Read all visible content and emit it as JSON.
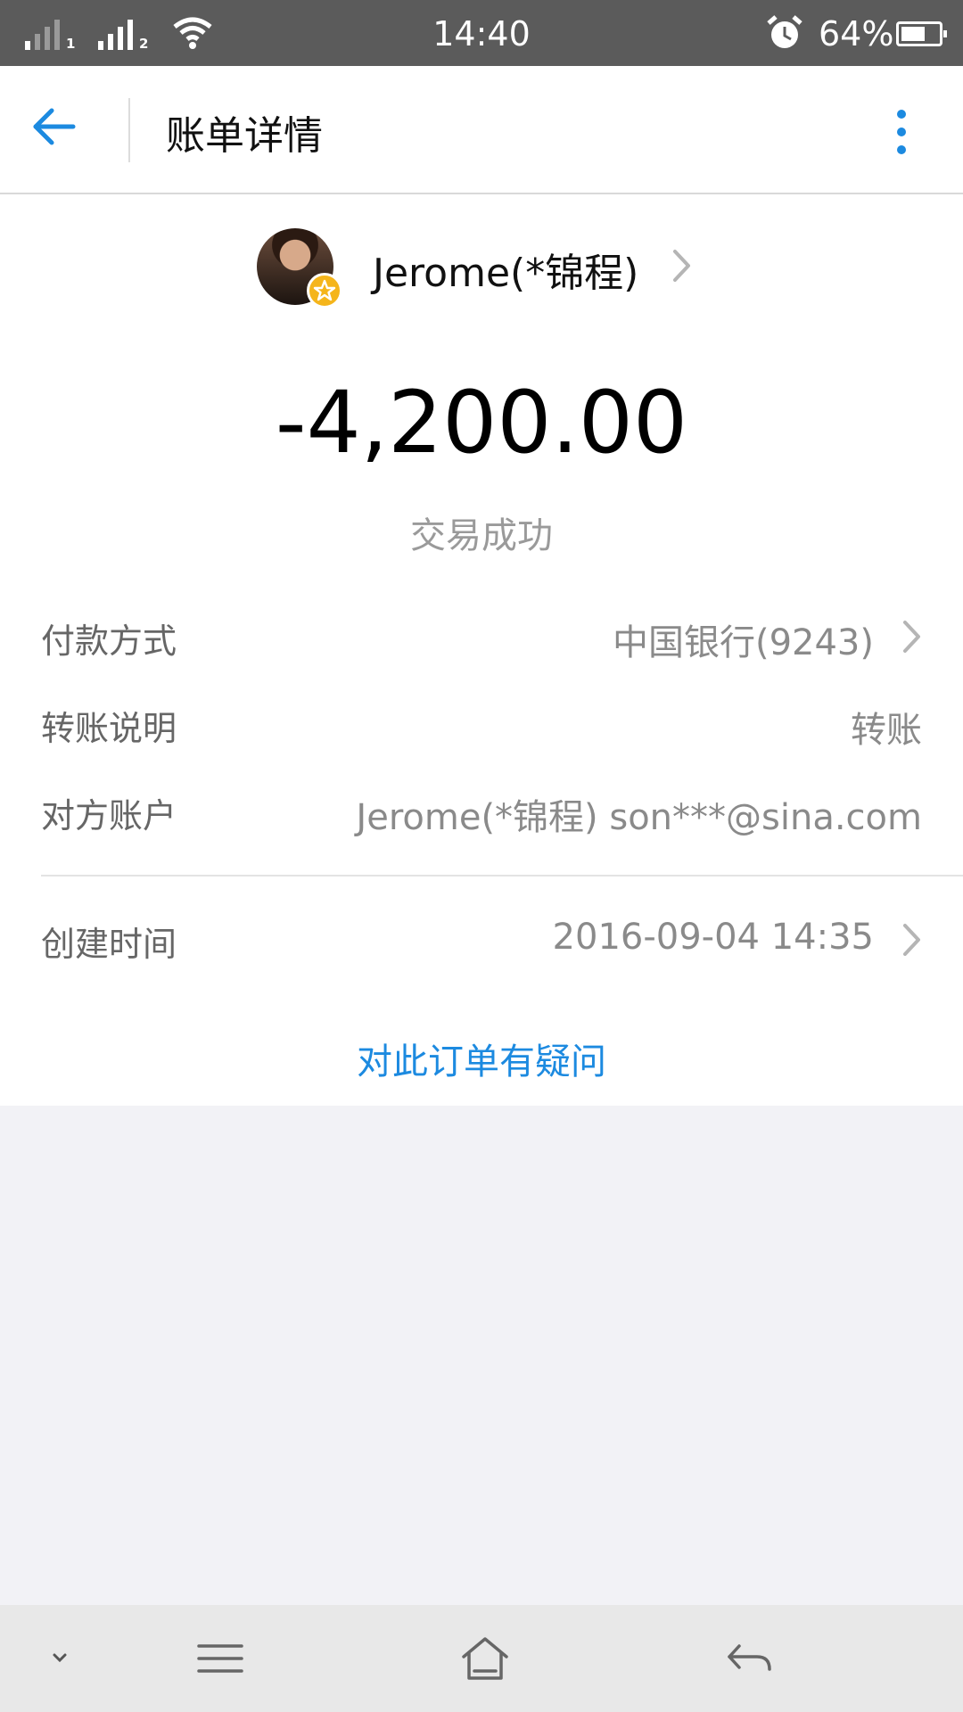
{
  "status_bar": {
    "sim1_label": "1",
    "sim2_label": "2",
    "time": "14:40",
    "battery_percent": "64%",
    "battery_level": 0.64,
    "icons": [
      "signal-icon",
      "wifi-icon",
      "alarm-icon",
      "battery-icon"
    ]
  },
  "header": {
    "title": "账单详情",
    "back_icon": "arrow-left-icon",
    "more_icon": "more-vertical-icon"
  },
  "payee": {
    "name": "Jerome(*锦程)",
    "badge_icon": "star-badge-icon"
  },
  "transaction": {
    "amount": "-4,200.00",
    "status": "交易成功"
  },
  "details": {
    "payment_method": {
      "label": "付款方式",
      "value": "中国银行(9243)"
    },
    "transfer_note": {
      "label": "转账说明",
      "value": "转账"
    },
    "counterparty": {
      "label": "对方账户",
      "value": "Jerome(*锦程) son***@sina.com"
    },
    "created_time": {
      "label": "创建时间",
      "value": "2016-09-04 14:35"
    }
  },
  "question_link": "对此订单有疑问",
  "nav_bar": {
    "icons": [
      "chevron-down-icon",
      "menu-icon",
      "home-icon",
      "back-icon"
    ]
  },
  "colors": {
    "accent": "#1c8ae0",
    "status_bar": "#5b5b5b",
    "background": "#f2f2f6"
  }
}
